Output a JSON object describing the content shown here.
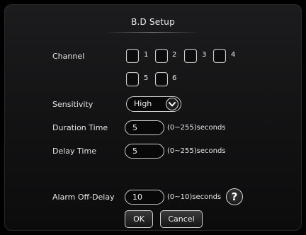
{
  "title": "B.D Setup",
  "channel": {
    "label": "Channel",
    "options": [
      "1",
      "2",
      "3",
      "4",
      "5",
      "6"
    ]
  },
  "sensitivity": {
    "label": "Sensitivity",
    "value": "High",
    "icon": "chevron-down-icon"
  },
  "duration_time": {
    "label": "Duration Time",
    "value": "5",
    "hint": "(0~255)seconds"
  },
  "delay_time": {
    "label": "Delay Time",
    "value": "5",
    "hint": "(0~255)seconds"
  },
  "alarm_off_delay": {
    "label": "Alarm Off-Delay",
    "value": "10",
    "hint": "(0~10)seconds",
    "help_icon": "?"
  },
  "buttons": {
    "ok": "OK",
    "cancel": "Cancel"
  }
}
